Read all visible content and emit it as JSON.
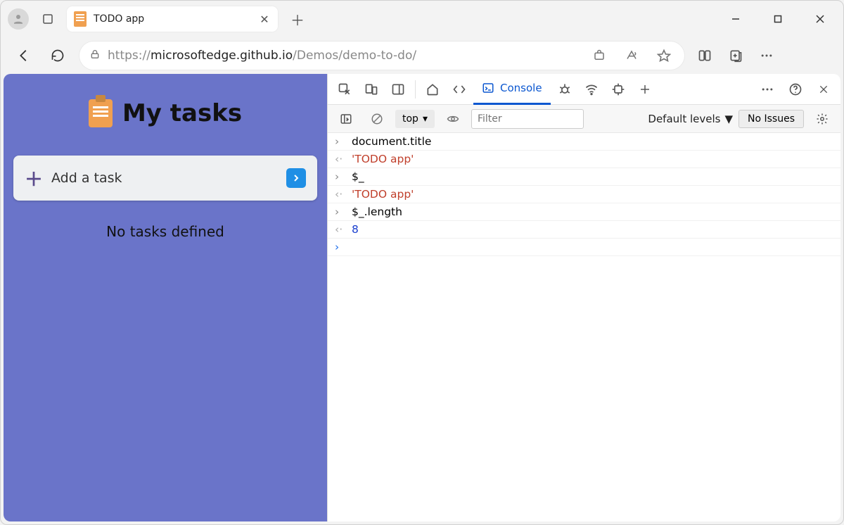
{
  "browser": {
    "tab_title": "TODO app",
    "url_prefix": "https://",
    "url_host": "microsoftedge.github.io",
    "url_path": "/Demos/demo-to-do/"
  },
  "page": {
    "heading": "My tasks",
    "add_task_label": "Add a task",
    "no_tasks": "No tasks defined"
  },
  "devtools": {
    "tabs": {
      "console": "Console"
    },
    "toolbar": {
      "context": "top",
      "filter_placeholder": "Filter",
      "levels": "Default levels",
      "issues": "No Issues"
    },
    "console": [
      {
        "type": "input",
        "text": "document.title"
      },
      {
        "type": "output",
        "kind": "string",
        "text": "'TODO app'"
      },
      {
        "type": "input",
        "text": "$_"
      },
      {
        "type": "output",
        "kind": "string",
        "text": "'TODO app'"
      },
      {
        "type": "input",
        "text": "$_.length"
      },
      {
        "type": "output",
        "kind": "number",
        "text": "8"
      }
    ]
  }
}
